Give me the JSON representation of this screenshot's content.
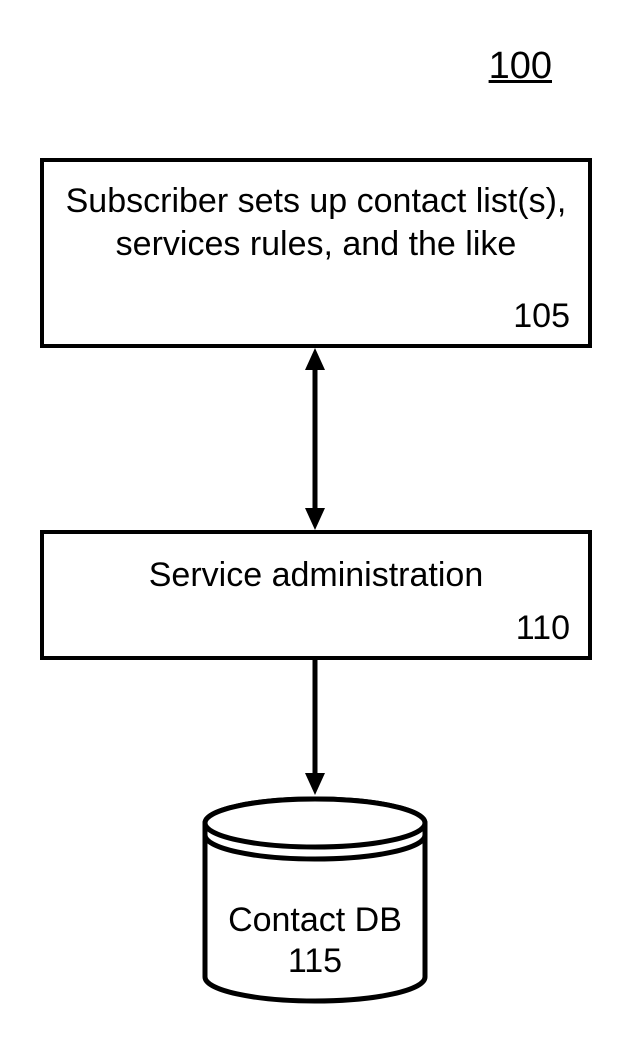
{
  "figureNumber": "100",
  "box1": {
    "text": "Subscriber sets up contact list(s), services rules, and the like",
    "ref": "105"
  },
  "box2": {
    "text": "Service administration",
    "ref": "110"
  },
  "db": {
    "name": "Contact DB",
    "ref": "115"
  }
}
